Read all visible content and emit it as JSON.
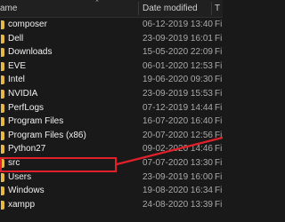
{
  "header": {
    "name_label": "ame",
    "date_label": "Date modified",
    "type_label": "T"
  },
  "rows": [
    {
      "name": "composer",
      "date": "06-12-2019 13:40",
      "type": "File"
    },
    {
      "name": "Dell",
      "date": "23-09-2019 16:01",
      "type": "File"
    },
    {
      "name": "Downloads",
      "date": "15-05-2020 22:09",
      "type": "File"
    },
    {
      "name": "EVE",
      "date": "06-01-2020 12:53",
      "type": "File"
    },
    {
      "name": "Intel",
      "date": "19-06-2020 09:30",
      "type": "File"
    },
    {
      "name": "NVIDIA",
      "date": "23-09-2019 15:53",
      "type": "File"
    },
    {
      "name": "PerfLogs",
      "date": "07-12-2019 14:44",
      "type": "File"
    },
    {
      "name": "Program Files",
      "date": "16-07-2020 16:40",
      "type": "File"
    },
    {
      "name": "Program Files (x86)",
      "date": "20-07-2020 12:56",
      "type": "File"
    },
    {
      "name": "Python27",
      "date": "09-02-2020 14:46",
      "type": "File"
    },
    {
      "name": "src",
      "date": "07-07-2020 13:30",
      "type": "File"
    },
    {
      "name": "Users",
      "date": "23-09-2019 16:00",
      "type": "File"
    },
    {
      "name": "Windows",
      "date": "19-08-2020 16:34",
      "type": "File"
    },
    {
      "name": "xampp",
      "date": "24-08-2020 13:39",
      "type": "File"
    }
  ],
  "colors": {
    "folder": "#e6b944",
    "highlight": "#e0202a",
    "background": "#191919"
  },
  "icons": {
    "folder": "folder-icon",
    "sort": "chevron-up-icon"
  }
}
